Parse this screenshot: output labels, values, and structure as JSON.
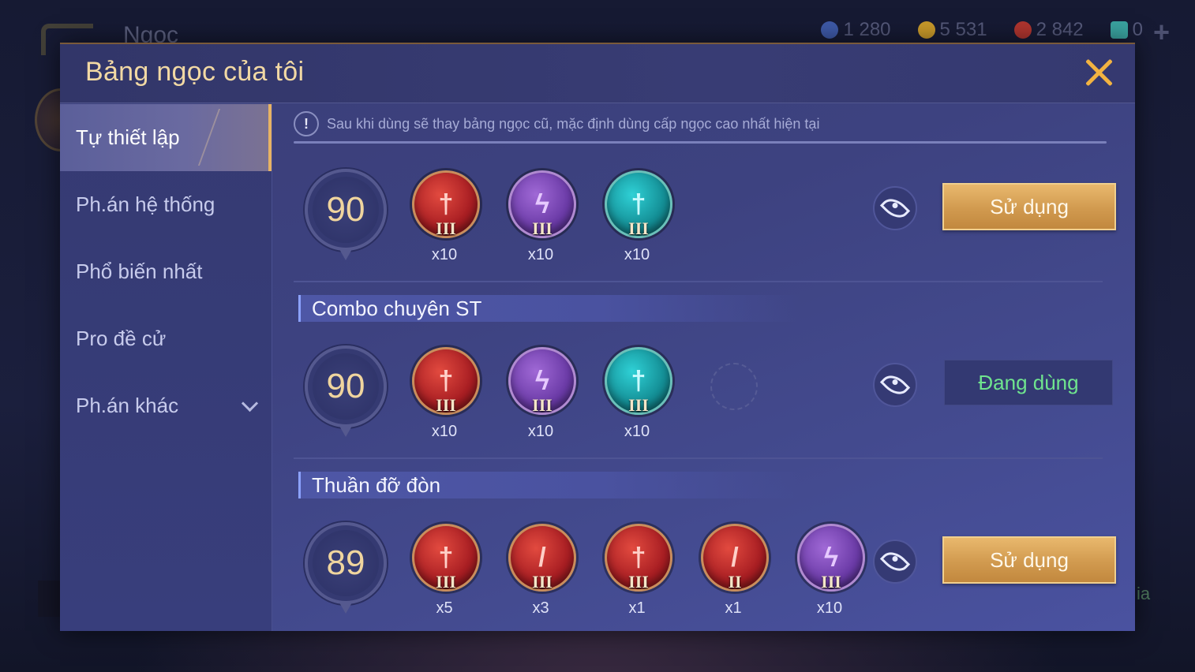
{
  "background": {
    "title": "Ngọc",
    "currencies": [
      {
        "icon": "gem-currency-icon",
        "value": "1 280",
        "color": "#3e5aa8"
      },
      {
        "icon": "gold-coin-icon",
        "value": "5 531",
        "color": "#c99a2a"
      },
      {
        "icon": "red-gem-icon",
        "value": "2 842",
        "color": "#b0352f"
      },
      {
        "icon": "ticket-icon",
        "value": "0",
        "color": "#3aa3a0"
      }
    ],
    "plus_label": "+",
    "side_text": "ia"
  },
  "modal": {
    "title": "Bảng ngọc của tôi",
    "close_label": "close"
  },
  "sidebar": {
    "items": [
      {
        "label": "Tự thiết lập",
        "active": true
      },
      {
        "label": "Ph.án hệ thống",
        "active": false
      },
      {
        "label": "Phổ biến nhất",
        "active": false
      },
      {
        "label": "Pro đề cử",
        "active": false
      },
      {
        "label": "Ph.án khác",
        "active": false,
        "expandable": true
      }
    ]
  },
  "notice": {
    "icon": "!",
    "text": "Sau khi dùng sẽ thay bảng ngọc cũ, mặc định dùng cấp ngọc cao nhất hiện tại"
  },
  "pages": [
    {
      "title": "",
      "level": "90",
      "gems": [
        {
          "color": "red",
          "glyph": "†",
          "tier": "III",
          "count": "x10"
        },
        {
          "color": "purple",
          "glyph": "ϟ",
          "tier": "III",
          "count": "x10"
        },
        {
          "color": "cyan",
          "glyph": "†",
          "tier": "III",
          "count": "x10"
        }
      ],
      "empty_slot": false,
      "action": {
        "type": "use",
        "label": "Sử dụng"
      }
    },
    {
      "title": "Combo chuyên ST",
      "level": "90",
      "gems": [
        {
          "color": "red",
          "glyph": "†",
          "tier": "III",
          "count": "x10"
        },
        {
          "color": "purple",
          "glyph": "ϟ",
          "tier": "III",
          "count": "x10"
        },
        {
          "color": "cyan",
          "glyph": "†",
          "tier": "III",
          "count": "x10"
        }
      ],
      "empty_slot": true,
      "action": {
        "type": "in-use",
        "label": "Đang dùng"
      }
    },
    {
      "title": "Thuần đỡ đòn",
      "level": "89",
      "gems": [
        {
          "color": "red",
          "glyph": "†",
          "tier": "III",
          "count": "x5"
        },
        {
          "color": "red",
          "glyph": "/",
          "tier": "III",
          "count": "x3"
        },
        {
          "color": "red",
          "glyph": "†",
          "tier": "III",
          "count": "x1"
        },
        {
          "color": "red",
          "glyph": "/",
          "tier": "II",
          "count": "x1"
        },
        {
          "color": "purple",
          "glyph": "ϟ",
          "tier": "III",
          "count": "x10"
        }
      ],
      "empty_slot": false,
      "action": {
        "type": "use",
        "label": "Sử dụng"
      }
    }
  ]
}
